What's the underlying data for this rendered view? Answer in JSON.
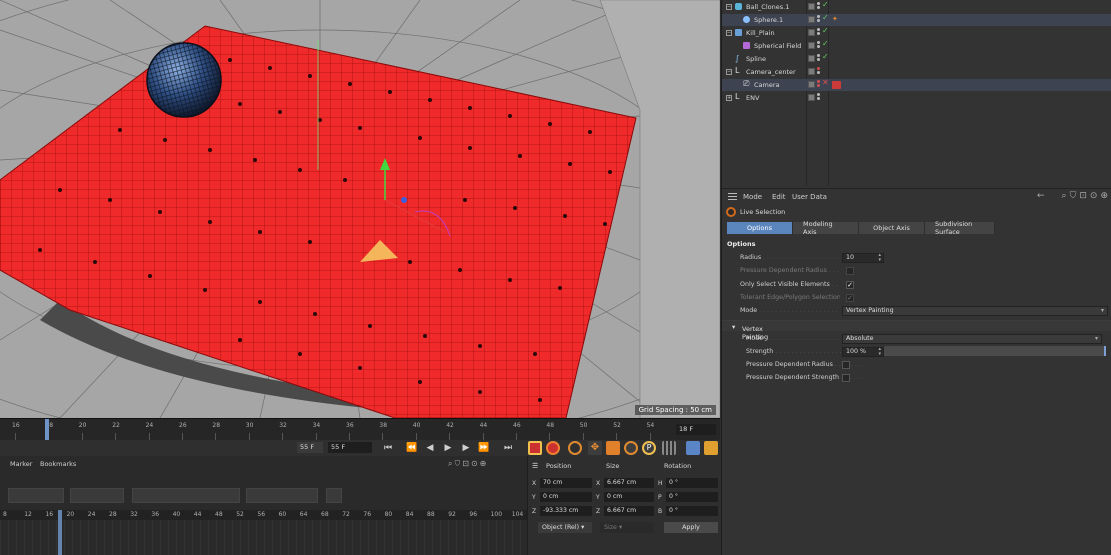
{
  "object_manager": {
    "objects": [
      {
        "name": "Ball_Clones.1",
        "icon": "cloner-icon"
      },
      {
        "name": "Sphere.1",
        "icon": "sphere-icon"
      },
      {
        "name": "Kill_Plain",
        "icon": "plain-effector-icon"
      },
      {
        "name": "Spherical Field",
        "icon": "field-icon"
      },
      {
        "name": "Spline",
        "icon": "spline-icon"
      },
      {
        "name": "Camera_center",
        "icon": "null-icon"
      },
      {
        "name": "Camera",
        "icon": "camera-icon"
      },
      {
        "name": "ENV",
        "icon": "null-icon"
      }
    ]
  },
  "attributes": {
    "menu": [
      "Mode",
      "Edit",
      "User Data"
    ],
    "tool_name": "Live Selection",
    "tabs": [
      "Options",
      "Modeling Axis",
      "Object Axis",
      "Subdivision Surface"
    ],
    "section": "Options",
    "radius_label": "Radius",
    "radius_value": "10",
    "pressure_radius_label": "Pressure Dependent Radius",
    "only_visible_label": "Only Select Visible Elements",
    "tolerant_label": "Tolerant Edge/Polygon Selection",
    "mode_label": "Mode",
    "mode_value": "Vertex Painting",
    "vp_section": "Vertex Painting",
    "vp_mode_label": "Mode",
    "vp_mode_value": "Absolute",
    "vp_strength_label": "Strength",
    "vp_strength_value": "100 %",
    "vp_pressure_radius_label": "Pressure Dependent Radius",
    "vp_pressure_strength_label": "Pressure Dependent Strength"
  },
  "viewport": {
    "grid_spacing": "Grid Spacing : 50 cm"
  },
  "timeline": {
    "ticks": [
      "16",
      "18",
      "20",
      "22",
      "24",
      "26",
      "28",
      "30",
      "32",
      "34",
      "36",
      "38",
      "40",
      "42",
      "44",
      "46",
      "48",
      "50",
      "52",
      "54"
    ],
    "current_frame": "18 F",
    "end_frame": "55 F",
    "end_frame2": "55 F"
  },
  "dopesheet": {
    "menu": [
      "Marker",
      "Bookmarks"
    ],
    "ticks": [
      "8",
      "12",
      "16",
      "20",
      "24",
      "28",
      "32",
      "36",
      "40",
      "44",
      "48",
      "52",
      "56",
      "60",
      "64",
      "68",
      "72",
      "76",
      "80",
      "84",
      "88",
      "92",
      "96",
      "100",
      "104"
    ]
  },
  "coordinates": {
    "headers": [
      "Position",
      "Size",
      "Rotation"
    ],
    "rows": [
      {
        "p_axis": "X",
        "p_val": "70 cm",
        "s_axis": "X",
        "s_val": "6.667 cm",
        "r_axis": "H",
        "r_val": "0 °"
      },
      {
        "p_axis": "Y",
        "p_val": "0 cm",
        "s_axis": "Y",
        "s_val": "0 cm",
        "r_axis": "P",
        "r_val": "0 °"
      },
      {
        "p_axis": "Z",
        "p_val": "-93.333 cm",
        "s_axis": "Z",
        "s_val": "6.667 cm",
        "r_axis": "B",
        "r_val": "0 °"
      }
    ],
    "space_select": "Object (Rel)",
    "size_select": "Size",
    "apply_label": "Apply"
  }
}
